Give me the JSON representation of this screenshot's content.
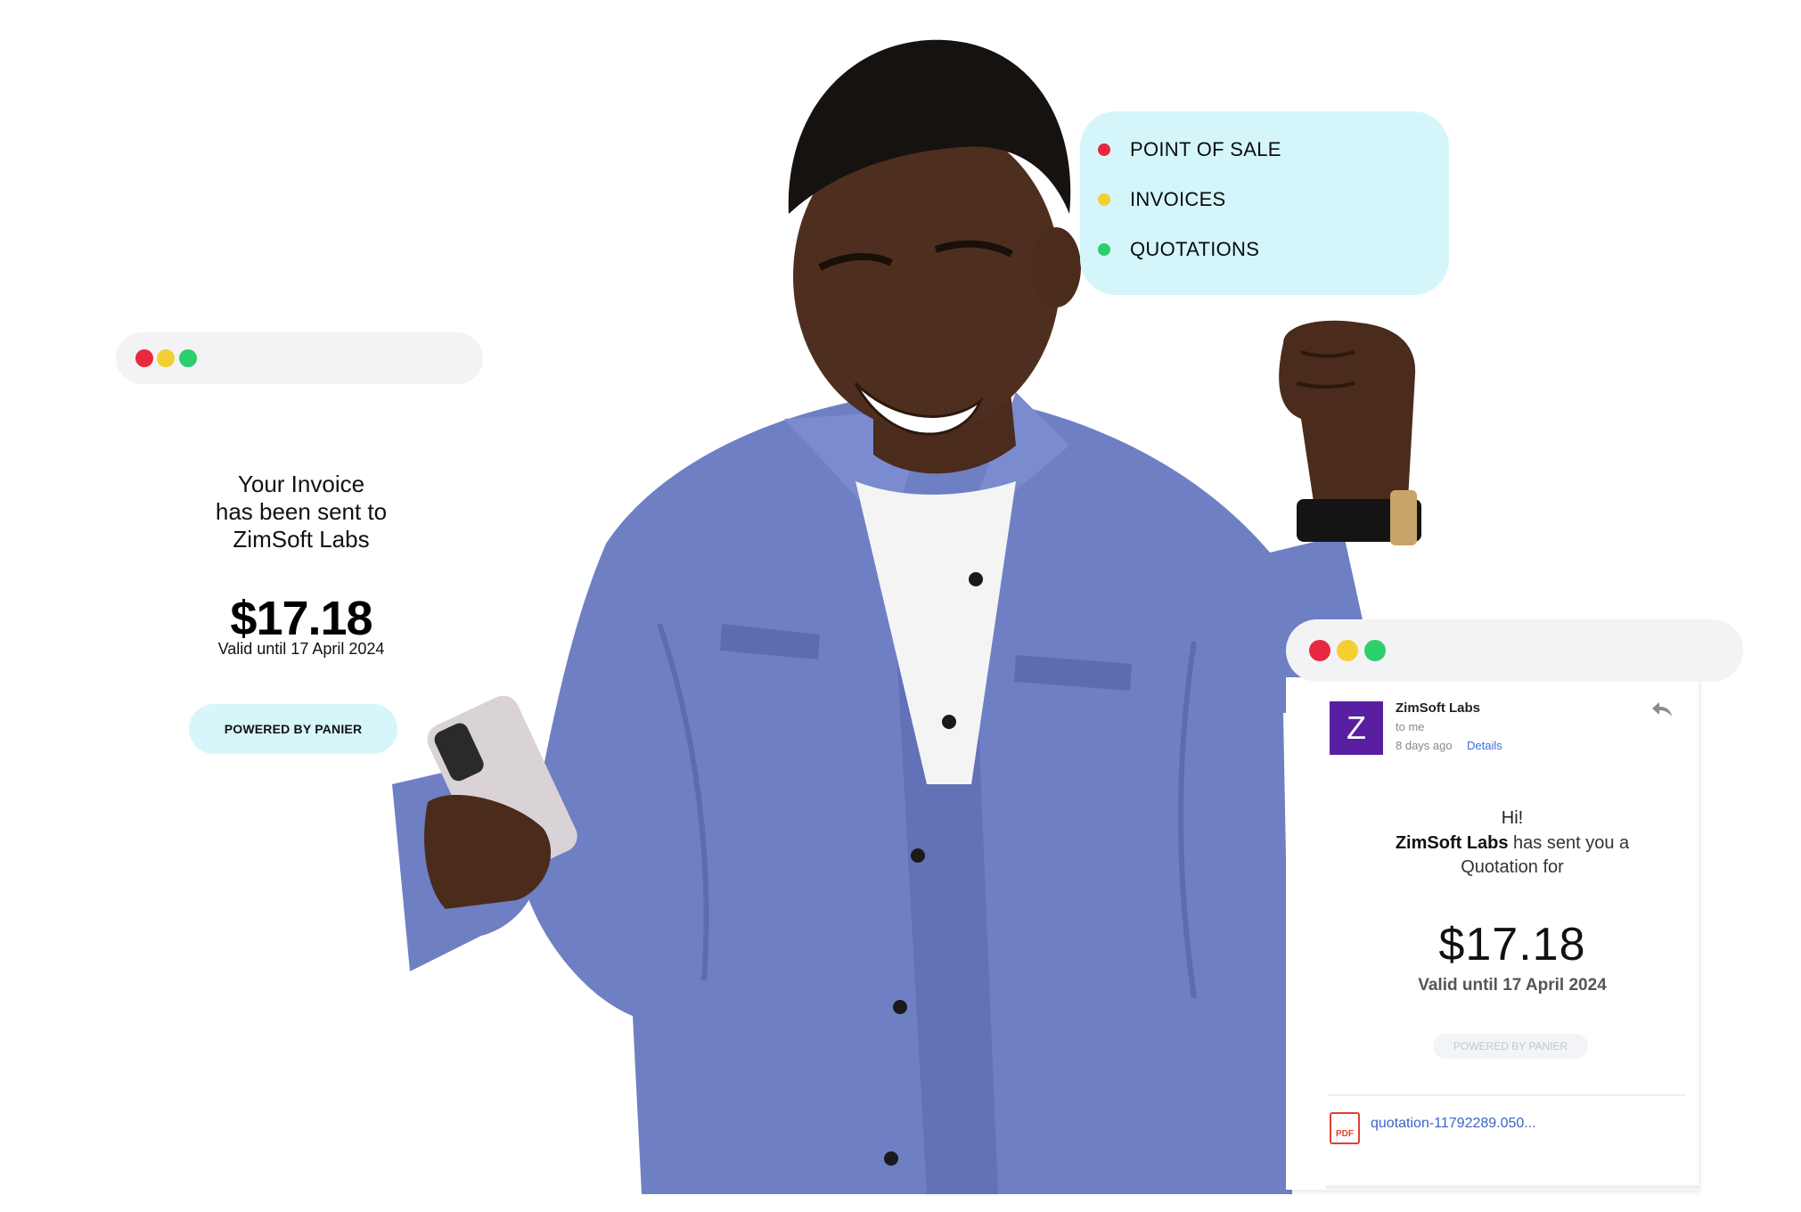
{
  "colors": {
    "dot_red": "#e8283f",
    "dot_yellow": "#f3cf32",
    "dot_green": "#2ccf6b",
    "feature_bg": "#d4f6fb",
    "pill_bg": "#d6f6fa",
    "shirt": "#6f7fc4",
    "avatar_bg": "#5a1fa0"
  },
  "left_card": {
    "invoice_line1": "Your Invoice",
    "invoice_line2": "has been sent to",
    "invoice_line3": "ZimSoft Labs",
    "amount": "$17.18",
    "valid": "Valid until 17 April 2024",
    "powered": "POWERED BY PANIER"
  },
  "features": [
    {
      "label": "POINT OF SALE",
      "color": "#e8283f"
    },
    {
      "label": "INVOICES",
      "color": "#f3cf32"
    },
    {
      "label": "QUOTATIONS",
      "color": "#2ccf6b"
    }
  ],
  "email": {
    "avatar_letter": "Z",
    "sender": "ZimSoft Labs",
    "to": "to me",
    "time": "8 days ago",
    "details_link": "Details",
    "greeting": "Hi!",
    "sender_bold": "ZimSoft Labs",
    "line2_rest": " has sent you a",
    "line3": "Quotation for",
    "amount": "$17.18",
    "valid": "Valid until 17 April 2024",
    "powered": "POWERED BY PANIER",
    "attachment_type": "PDF",
    "attachment_name": "quotation-11792289.050..."
  }
}
